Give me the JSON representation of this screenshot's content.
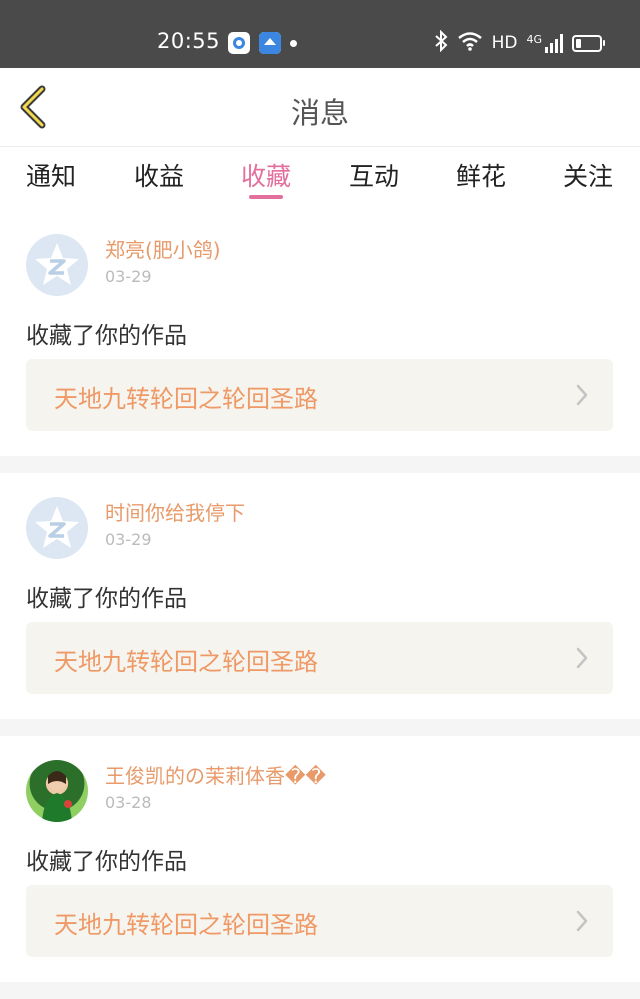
{
  "status_bar": {
    "time": "20:55",
    "hd": "HD",
    "network": "4G"
  },
  "header": {
    "title": "消息"
  },
  "tabs": [
    {
      "label": "通知"
    },
    {
      "label": "收益"
    },
    {
      "label": "收藏"
    },
    {
      "label": "互动"
    },
    {
      "label": "鲜花"
    },
    {
      "label": "关注"
    }
  ],
  "active_tab": "收藏",
  "messages": [
    {
      "username": "郑亮(肥小鸽)",
      "date": "03-29",
      "action": "收藏了你的作品",
      "work_title": "天地九转轮回之轮回圣路"
    },
    {
      "username": "时间你给我停下",
      "date": "03-29",
      "action": "收藏了你的作品",
      "work_title": "天地九转轮回之轮回圣路"
    },
    {
      "username": "王俊凯的の茉莉体香��",
      "date": "03-28",
      "action": "收藏了你的作品",
      "work_title": "天地九转轮回之轮回圣路"
    }
  ],
  "colors": {
    "accent": "#e36f9c",
    "username": "#e89a6a",
    "work_title": "#ef9966",
    "status_bar_bg": "#4a4a4a"
  }
}
